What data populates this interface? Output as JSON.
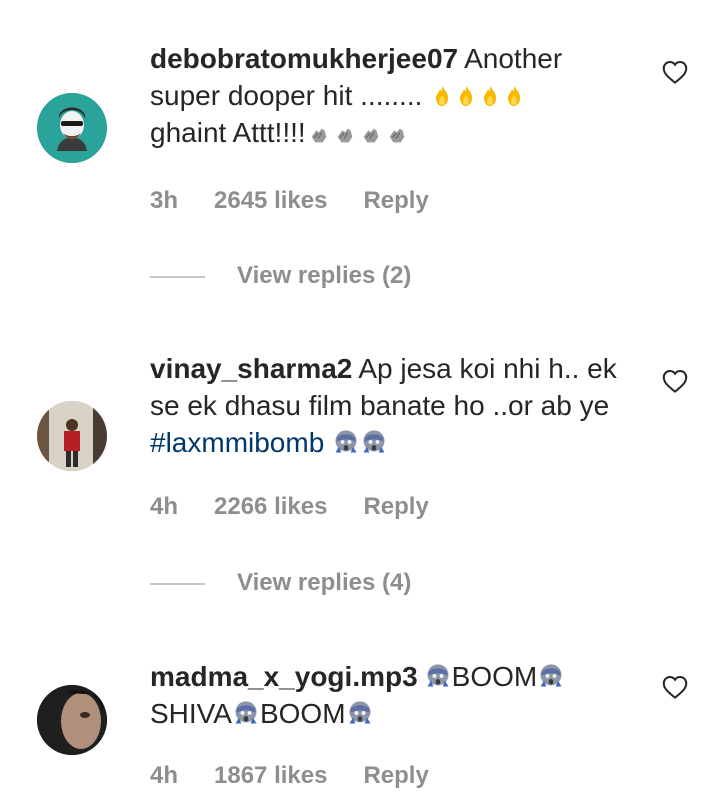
{
  "comments": [
    {
      "username": "debobratomukherjee07",
      "text": "Another super dooper hit ........",
      "text2": "ghaint Attt!!!!",
      "time": "3h",
      "likes": "2645 likes",
      "reply": "Reply",
      "view_replies": "View replies (2)",
      "icons": [
        "fire-emoji",
        "fire-emoji",
        "fire-emoji",
        "fire-emoji",
        "clapping-hands-emoji"
      ]
    },
    {
      "username": "vinay_sharma2",
      "text": "Ap jesa koi nhi h.. ek se ek dhasu film banate ho ..or ab ye",
      "hashtag": "#laxmmibomb",
      "time": "4h",
      "likes": "2266 likes",
      "reply": "Reply",
      "view_replies": "View replies (4)",
      "icons": [
        "fearful-face-emoji",
        "fearful-face-emoji"
      ]
    },
    {
      "username": "madma_x_yogi.mp3",
      "seg1": "BOOM",
      "seg2": "SHIVA",
      "seg3": "BOOM",
      "time": "4h",
      "likes": "1867 likes",
      "reply": "Reply",
      "icons": [
        "fearful-face-emoji"
      ]
    }
  ]
}
